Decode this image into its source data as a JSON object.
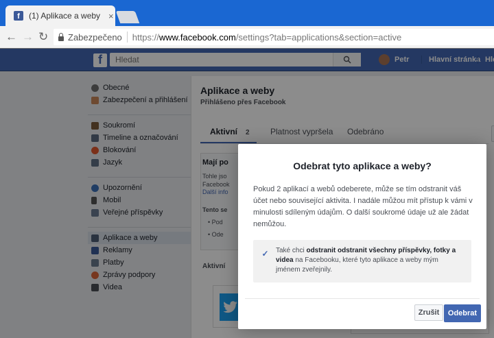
{
  "browser": {
    "tab_title": "(1) Aplikace a weby",
    "tab_close": "×",
    "secure_label": "Zabezpečeno",
    "url_scheme": "https://",
    "url_host": "www.facebook.com",
    "url_rest": "/settings?tab=applications&section=active"
  },
  "fb_header": {
    "logo": "f",
    "search_placeholder": "Hledat",
    "user_name": "Petr",
    "home": "Hlavní stránka",
    "find": "Hledat"
  },
  "sidebar": {
    "groups": [
      [
        {
          "label": "Obecné",
          "icon": "gear-icon"
        },
        {
          "label": "Zabezpečení a přihlášení",
          "icon": "shield-icon"
        }
      ],
      [
        {
          "label": "Soukromí",
          "icon": "lock-icon"
        },
        {
          "label": "Timeline a označování",
          "icon": "timeline-icon"
        },
        {
          "label": "Blokování",
          "icon": "block-icon"
        },
        {
          "label": "Jazyk",
          "icon": "language-icon"
        }
      ],
      [
        {
          "label": "Upozornění",
          "icon": "globe-icon"
        },
        {
          "label": "Mobil",
          "icon": "mobile-icon"
        },
        {
          "label": "Veřejné příspěvky",
          "icon": "rss-icon"
        }
      ],
      [
        {
          "label": "Aplikace a weby",
          "icon": "apps-icon",
          "selected": true
        },
        {
          "label": "Reklamy",
          "icon": "ads-icon"
        },
        {
          "label": "Platby",
          "icon": "card-icon"
        },
        {
          "label": "Zprávy podpory",
          "icon": "lifebuoy-icon"
        },
        {
          "label": "Videa",
          "icon": "video-icon"
        }
      ]
    ]
  },
  "content": {
    "title": "Aplikace a weby",
    "subtitle": "Přihlášeno přes Facebook",
    "tabs": [
      {
        "label": "Aktivní",
        "count": "2"
      },
      {
        "label": "Platnost vypršela"
      },
      {
        "label": "Odebráno"
      }
    ],
    "box_title": "Mají po",
    "box_text_1": "Tohle jso",
    "box_text_2": "Facebook",
    "box_link": "Další info",
    "box_section": "Tento se",
    "bullet_1": "Pod",
    "bullet_2": "Ode",
    "active_label": "Aktivní"
  },
  "dialog": {
    "title": "Odebrat tyto aplikace a weby?",
    "body": "Pokud 2 aplikací a webů odeberete, může se tím odstranit váš účet nebo související aktivita. I nadále můžou mít přístup k vámi v minulosti sdíleným údajům. O další soukromé údaje už ale žádat nemůžou.",
    "checkbox_checked": true,
    "check_pre": "Také chci ",
    "check_bold_1": "odstranit odstranit všechny příspěvky, fotky a videa",
    "check_post": " na Facebooku, které tyto aplikace a weby mým jménem zveřejnily.",
    "cancel_label": "Zrušit",
    "remove_label": "Odebrat"
  }
}
